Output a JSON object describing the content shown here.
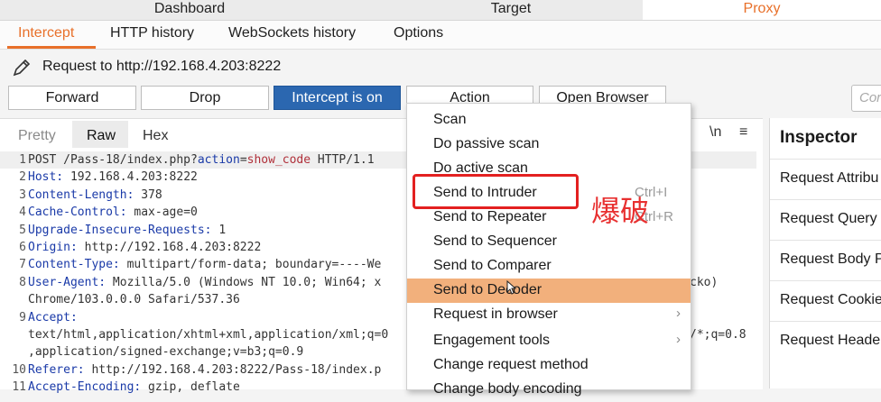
{
  "top_tabs": [
    "Dashboard",
    "Target",
    "Proxy"
  ],
  "sub_tabs": [
    "Intercept",
    "HTTP history",
    "WebSockets history",
    "Options"
  ],
  "request_title": "Request to http://192.168.4.203:8222",
  "buttons": {
    "forward": "Forward",
    "drop": "Drop",
    "intercept": "Intercept is on",
    "action": "Action",
    "open_browser": "Open Browser"
  },
  "search": {
    "placeholder": "Cor"
  },
  "editor": {
    "tabs": [
      "Pretty",
      "Raw",
      "Hex"
    ],
    "tools": [
      "\\n",
      "≡"
    ],
    "lines": [
      {
        "n": "1",
        "a": "POST /Pass-18/index.php?",
        "b": "action",
        "c": "=",
        "d": "show_code",
        "e": " HTTP/1.1"
      },
      {
        "n": "2",
        "k": "Host:",
        "v": " 192.168.4.203:8222"
      },
      {
        "n": "3",
        "k": "Content-Length:",
        "v": " 378"
      },
      {
        "n": "4",
        "k": "Cache-Control:",
        "v": " max-age=0"
      },
      {
        "n": "5",
        "k": "Upgrade-Insecure-Requests:",
        "v": " 1"
      },
      {
        "n": "6",
        "k": "Origin:",
        "v": " http://192.168.4.203:8222"
      },
      {
        "n": "7",
        "k": "Content-Type:",
        "v": " multipart/form-data; boundary=----We"
      },
      {
        "n": "8",
        "k": "User-Agent:",
        "v": " Mozilla/5.0 (Windows NT 10.0; Win64; x",
        "tail": "cko)"
      },
      {
        "n": "",
        "v": "Chrome/103.0.0.0 Safari/537.36"
      },
      {
        "n": "9",
        "k": "Accept:",
        "v": ""
      },
      {
        "n": "",
        "v": "text/html,application/xhtml+xml,application/xml;q=0",
        "tail": "/*;q=0.8"
      },
      {
        "n": "",
        "v": ",application/signed-exchange;v=b3;q=0.9"
      },
      {
        "n": "10",
        "k": "Referer:",
        "v": " http://192.168.4.203:8222/Pass-18/index.p"
      },
      {
        "n": "11",
        "k": "Accept-Encoding:",
        "v": " gzip, deflate"
      }
    ]
  },
  "inspector": {
    "title": "Inspector",
    "rows": [
      "Request Attribu",
      "Request Query",
      "Request Body P",
      "Request Cookie",
      "Request Heade"
    ]
  },
  "menu": {
    "items": [
      {
        "label": "Scan",
        "shortcut": "",
        "submenu": false
      },
      {
        "label": "Do passive scan",
        "shortcut": "",
        "submenu": false
      },
      {
        "label": "Do active scan",
        "shortcut": "",
        "submenu": false
      },
      {
        "label": "Send to Intruder",
        "shortcut": "Ctrl+I",
        "submenu": false
      },
      {
        "label": "Send to Repeater",
        "shortcut": "Ctrl+R",
        "submenu": false
      },
      {
        "label": "Send to Sequencer",
        "shortcut": "",
        "submenu": false
      },
      {
        "label": "Send to Comparer",
        "shortcut": "",
        "submenu": false
      },
      {
        "label": "Send to Decoder",
        "shortcut": "",
        "submenu": false
      },
      {
        "label": "Request in browser",
        "shortcut": "",
        "submenu": true
      },
      {
        "label": "Engagement tools",
        "shortcut": "",
        "submenu": true
      },
      {
        "label": "Change request method",
        "shortcut": "",
        "submenu": false
      },
      {
        "label": "Change body encoding",
        "shortcut": "",
        "submenu": false
      }
    ],
    "hover_index": 7
  },
  "annotation": "爆破",
  "colors": {
    "accent": "#e8702a",
    "primary_button": "#2b67b0",
    "hover": "#f2b07c",
    "annotation": "#e32020"
  }
}
